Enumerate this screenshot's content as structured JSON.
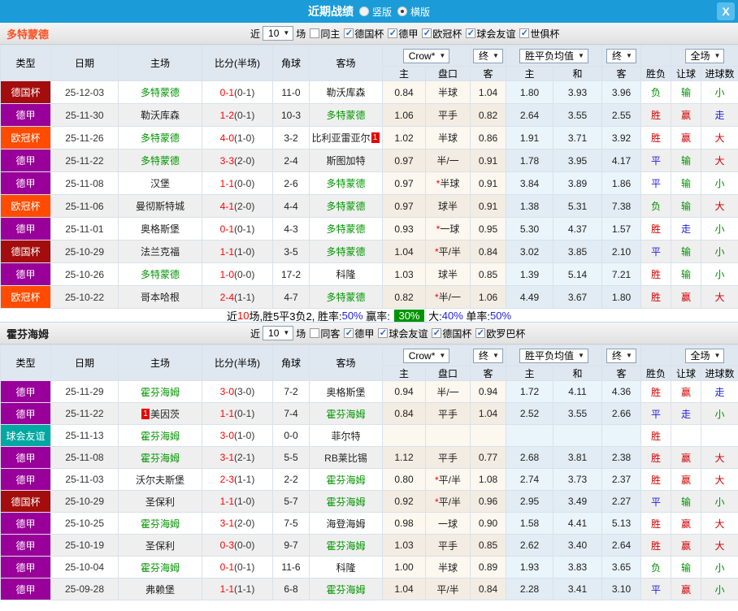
{
  "window": {
    "title": "近期战绩"
  },
  "icons": {
    "close": "X",
    "dropdown_arrow": "▼",
    "check": "✓"
  },
  "view_toggle": {
    "options": [
      {
        "label": "竖版",
        "selected": false
      },
      {
        "label": "横版",
        "selected": true
      }
    ]
  },
  "colors": {
    "titlebar": "#1b9cd9",
    "type_badges": {
      "德国杯": "#a40d0d",
      "德甲": "#990099",
      "欧冠杯": "#ff4c00",
      "球会友谊": "#00a8a2"
    },
    "result_map": {
      "胜": "red",
      "赢": "red",
      "大": "red",
      "平": "blue",
      "走": "blue",
      "负": "green",
      "输": "green",
      "小": "green"
    }
  },
  "table_header": {
    "cols": [
      "类型",
      "日期",
      "主场",
      "比分(半场)",
      "角球",
      "客场"
    ],
    "dd_crow": "Crow*",
    "dd_final": "终",
    "dd_avg": "胜平负均值",
    "dd_scope": "全场",
    "sub": [
      "主",
      "盘口",
      "客",
      "主",
      "和",
      "客",
      "胜负",
      "让球",
      "进球数"
    ]
  },
  "sections": [
    {
      "team": "多特蒙德",
      "team_color": "#ff5122",
      "filter": {
        "prefix": "近",
        "count": "10",
        "suffix": "场",
        "checkboxes": [
          {
            "label": "同主",
            "checked": false
          },
          {
            "label": "德国杯",
            "checked": true
          },
          {
            "label": "德甲",
            "checked": true
          },
          {
            "label": "欧冠杯",
            "checked": true
          },
          {
            "label": "球会友谊",
            "checked": true
          },
          {
            "label": "世俱杯",
            "checked": true
          }
        ]
      },
      "rows": [
        {
          "type": "德国杯",
          "date": "25-12-03",
          "home": "多特蒙德",
          "home_red": "",
          "score": "0-1",
          "half": "(0-1)",
          "corners": "11-0",
          "away": "勒沃库森",
          "away_red": "",
          "crow": [
            "0.84",
            "半球",
            "1.04"
          ],
          "odds": [
            "1.80",
            "3.93",
            "3.96"
          ],
          "results": [
            "负",
            "输",
            "小"
          ]
        },
        {
          "type": "德甲",
          "date": "25-11-30",
          "home": "勒沃库森",
          "home_red": "",
          "score": "1-2",
          "half": "(0-1)",
          "corners": "10-3",
          "away": "多特蒙德",
          "away_red": "",
          "crow": [
            "1.06",
            "平手",
            "0.82"
          ],
          "odds": [
            "2.64",
            "3.55",
            "2.55"
          ],
          "results": [
            "胜",
            "赢",
            "走"
          ]
        },
        {
          "type": "欧冠杯",
          "date": "25-11-26",
          "home": "多特蒙德",
          "home_red": "",
          "score": "4-0",
          "half": "(1-0)",
          "corners": "3-2",
          "away": "比利亚雷亚尔",
          "away_red": "1",
          "crow": [
            "1.02",
            "半球",
            "0.86"
          ],
          "odds": [
            "1.91",
            "3.71",
            "3.92"
          ],
          "results": [
            "胜",
            "赢",
            "大"
          ]
        },
        {
          "type": "德甲",
          "date": "25-11-22",
          "home": "多特蒙德",
          "home_red": "",
          "score": "3-3",
          "half": "(2-0)",
          "corners": "2-4",
          "away": "斯图加特",
          "away_red": "",
          "crow": [
            "0.97",
            "半/一",
            "0.91"
          ],
          "odds": [
            "1.78",
            "3.95",
            "4.17"
          ],
          "results": [
            "平",
            "输",
            "大"
          ]
        },
        {
          "type": "德甲",
          "date": "25-11-08",
          "home": "汉堡",
          "home_red": "",
          "score": "1-1",
          "half": "(0-0)",
          "corners": "2-6",
          "away": "多特蒙德",
          "away_red": "",
          "crow": [
            "0.97",
            "*半球",
            "0.91"
          ],
          "odds": [
            "3.84",
            "3.89",
            "1.86"
          ],
          "results": [
            "平",
            "输",
            "小"
          ]
        },
        {
          "type": "欧冠杯",
          "date": "25-11-06",
          "home": "曼彻斯特城",
          "home_red": "",
          "score": "4-1",
          "half": "(2-0)",
          "corners": "4-4",
          "away": "多特蒙德",
          "away_red": "",
          "crow": [
            "0.97",
            "球半",
            "0.91"
          ],
          "odds": [
            "1.38",
            "5.31",
            "7.38"
          ],
          "results": [
            "负",
            "输",
            "大"
          ]
        },
        {
          "type": "德甲",
          "date": "25-11-01",
          "home": "奥格斯堡",
          "home_red": "",
          "score": "0-1",
          "half": "(0-1)",
          "corners": "4-3",
          "away": "多特蒙德",
          "away_red": "",
          "crow": [
            "0.93",
            "*一球",
            "0.95"
          ],
          "odds": [
            "5.30",
            "4.37",
            "1.57"
          ],
          "results": [
            "胜",
            "走",
            "小"
          ]
        },
        {
          "type": "德国杯",
          "date": "25-10-29",
          "home": "法兰克福",
          "home_red": "",
          "score": "1-1",
          "half": "(1-0)",
          "corners": "3-5",
          "away": "多特蒙德",
          "away_red": "",
          "crow": [
            "1.04",
            "*平/半",
            "0.84"
          ],
          "odds": [
            "3.02",
            "3.85",
            "2.10"
          ],
          "results": [
            "平",
            "输",
            "小"
          ]
        },
        {
          "type": "德甲",
          "date": "25-10-26",
          "home": "多特蒙德",
          "home_red": "",
          "score": "1-0",
          "half": "(0-0)",
          "corners": "17-2",
          "away": "科隆",
          "away_red": "",
          "crow": [
            "1.03",
            "球半",
            "0.85"
          ],
          "odds": [
            "1.39",
            "5.14",
            "7.21"
          ],
          "results": [
            "胜",
            "输",
            "小"
          ]
        },
        {
          "type": "欧冠杯",
          "date": "25-10-22",
          "home": "哥本哈根",
          "home_red": "",
          "score": "2-4",
          "half": "(1-1)",
          "corners": "4-7",
          "away": "多特蒙德",
          "away_red": "",
          "crow": [
            "0.82",
            "*半/一",
            "1.06"
          ],
          "odds": [
            "4.49",
            "3.67",
            "1.80"
          ],
          "results": [
            "胜",
            "赢",
            "大"
          ]
        }
      ],
      "summary": [
        {
          "text": "近",
          "style": "plain"
        },
        {
          "text": "10",
          "style": "red"
        },
        {
          "text": "场,胜5平3负2, 胜率:",
          "style": "plain"
        },
        {
          "text": "50%",
          "style": "blue"
        },
        {
          "text": " 赢率: ",
          "style": "plain"
        },
        {
          "text": "30%",
          "style": "badge"
        },
        {
          "text": " 大:",
          "style": "plain"
        },
        {
          "text": "40%",
          "style": "blue"
        },
        {
          "text": " 单率:",
          "style": "plain"
        },
        {
          "text": "50%",
          "style": "blue"
        }
      ]
    },
    {
      "team": "霍芬海姆",
      "team_color": "#1a1a1a",
      "filter": {
        "prefix": "近",
        "count": "10",
        "suffix": "场",
        "checkboxes": [
          {
            "label": "同客",
            "checked": false
          },
          {
            "label": "德甲",
            "checked": true
          },
          {
            "label": "球会友谊",
            "checked": true
          },
          {
            "label": "德国杯",
            "checked": true
          },
          {
            "label": "欧罗巴杯",
            "checked": true
          }
        ]
      },
      "rows": [
        {
          "type": "德甲",
          "date": "25-11-29",
          "home": "霍芬海姆",
          "home_red": "",
          "score": "3-0",
          "half": "(3-0)",
          "corners": "7-2",
          "away": "奥格斯堡",
          "away_red": "",
          "crow": [
            "0.94",
            "半/一",
            "0.94"
          ],
          "odds": [
            "1.72",
            "4.11",
            "4.36"
          ],
          "results": [
            "胜",
            "赢",
            "走"
          ]
        },
        {
          "type": "德甲",
          "date": "25-11-22",
          "home": "美因茨",
          "home_red": "1",
          "score": "1-1",
          "half": "(0-1)",
          "corners": "7-4",
          "away": "霍芬海姆",
          "away_red": "",
          "crow": [
            "0.84",
            "平手",
            "1.04"
          ],
          "odds": [
            "2.52",
            "3.55",
            "2.66"
          ],
          "results": [
            "平",
            "走",
            "小"
          ]
        },
        {
          "type": "球会友谊",
          "date": "25-11-13",
          "home": "霍芬海姆",
          "home_red": "",
          "score": "3-0",
          "half": "(1-0)",
          "corners": "0-0",
          "away": "菲尔特",
          "away_red": "",
          "crow": [
            "",
            "",
            ""
          ],
          "odds": [
            "",
            "",
            ""
          ],
          "results": [
            "胜",
            "",
            ""
          ]
        },
        {
          "type": "德甲",
          "date": "25-11-08",
          "home": "霍芬海姆",
          "home_red": "",
          "score": "3-1",
          "half": "(2-1)",
          "corners": "5-5",
          "away": "RB莱比锡",
          "away_red": "",
          "crow": [
            "1.12",
            "平手",
            "0.77"
          ],
          "odds": [
            "2.68",
            "3.81",
            "2.38"
          ],
          "results": [
            "胜",
            "赢",
            "大"
          ]
        },
        {
          "type": "德甲",
          "date": "25-11-03",
          "home": "沃尔夫斯堡",
          "home_red": "",
          "score": "2-3",
          "half": "(1-1)",
          "corners": "2-2",
          "away": "霍芬海姆",
          "away_red": "",
          "crow": [
            "0.80",
            "*平/半",
            "1.08"
          ],
          "odds": [
            "2.74",
            "3.73",
            "2.37"
          ],
          "results": [
            "胜",
            "赢",
            "大"
          ]
        },
        {
          "type": "德国杯",
          "date": "25-10-29",
          "home": "圣保利",
          "home_red": "",
          "score": "1-1",
          "half": "(1-0)",
          "corners": "5-7",
          "away": "霍芬海姆",
          "away_red": "",
          "crow": [
            "0.92",
            "*平/半",
            "0.96"
          ],
          "odds": [
            "2.95",
            "3.49",
            "2.27"
          ],
          "results": [
            "平",
            "输",
            "小"
          ]
        },
        {
          "type": "德甲",
          "date": "25-10-25",
          "home": "霍芬海姆",
          "home_red": "",
          "score": "3-1",
          "half": "(2-0)",
          "corners": "7-5",
          "away": "海登海姆",
          "away_red": "",
          "crow": [
            "0.98",
            "一球",
            "0.90"
          ],
          "odds": [
            "1.58",
            "4.41",
            "5.13"
          ],
          "results": [
            "胜",
            "赢",
            "大"
          ]
        },
        {
          "type": "德甲",
          "date": "25-10-19",
          "home": "圣保利",
          "home_red": "",
          "score": "0-3",
          "half": "(0-0)",
          "corners": "9-7",
          "away": "霍芬海姆",
          "away_red": "",
          "crow": [
            "1.03",
            "平手",
            "0.85"
          ],
          "odds": [
            "2.62",
            "3.40",
            "2.64"
          ],
          "results": [
            "胜",
            "赢",
            "大"
          ]
        },
        {
          "type": "德甲",
          "date": "25-10-04",
          "home": "霍芬海姆",
          "home_red": "",
          "score": "0-1",
          "half": "(0-1)",
          "corners": "11-6",
          "away": "科隆",
          "away_red": "",
          "crow": [
            "1.00",
            "半球",
            "0.89"
          ],
          "odds": [
            "1.93",
            "3.83",
            "3.65"
          ],
          "results": [
            "负",
            "输",
            "小"
          ]
        },
        {
          "type": "德甲",
          "date": "25-09-28",
          "home": "弗赖堡",
          "home_red": "",
          "score": "1-1",
          "half": "(1-1)",
          "corners": "6-8",
          "away": "霍芬海姆",
          "away_red": "",
          "crow": [
            "1.04",
            "平/半",
            "0.84"
          ],
          "odds": [
            "2.28",
            "3.41",
            "3.10"
          ],
          "results": [
            "平",
            "赢",
            "小"
          ]
        }
      ],
      "summary": null
    }
  ]
}
